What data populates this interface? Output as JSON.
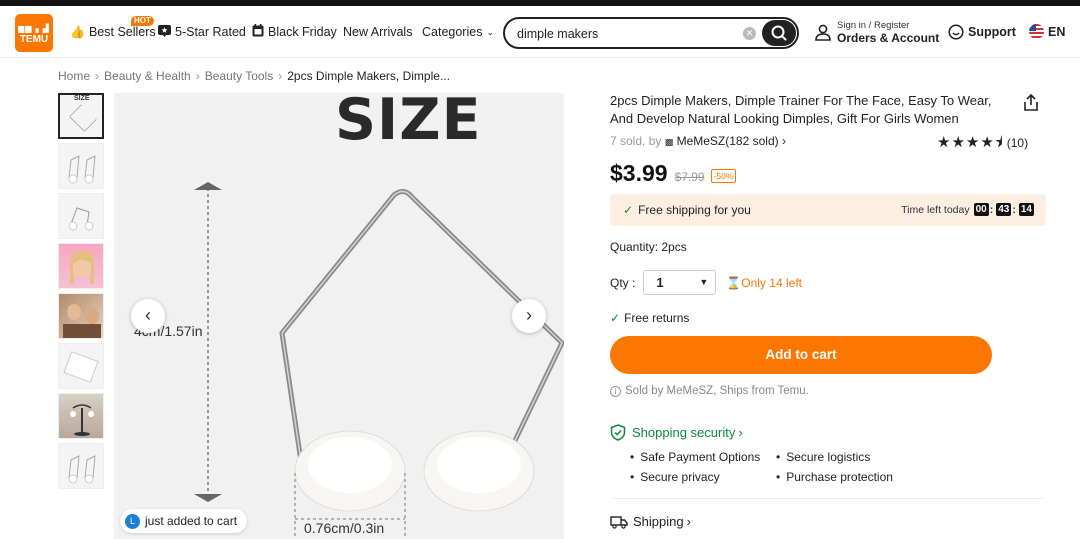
{
  "header": {
    "logo_top": "▆▆ ▖▟",
    "logo_text": "TEMU",
    "nav": [
      {
        "label": "Best Sellers",
        "icon": "thumbs-up-icon",
        "badge": "HOT"
      },
      {
        "label": "5-Star Rated",
        "icon": "star-badge-icon"
      },
      {
        "label": "Black Friday",
        "icon": "calendar-icon"
      },
      {
        "label": "New Arrivals"
      },
      {
        "label": "Categories",
        "icon": "chevron-down-icon"
      }
    ],
    "search_value": "dimple makers",
    "account_small": "Sign in / Register",
    "account_big": "Orders & Account",
    "support": "Support",
    "lang": "EN"
  },
  "breadcrumb": [
    "Home",
    "Beauty & Health",
    "Beauty Tools",
    "2pcs Dimple Makers, Dimple..."
  ],
  "gallery": {
    "size_label": "SIZE",
    "dim_height": "4cm/1.57in",
    "dim_width": "0.76cm/0.3in",
    "toast_avatar": "L",
    "toast_text": "just added to cart"
  },
  "product": {
    "title": "2pcs Dimple Makers, Dimple Trainer For The Face, Easy To Wear, And Develop Natural Looking Dimples, Gift For Girls Women",
    "sold_prefix": "7 sold, by",
    "store": "MeMeSZ(182 sold)",
    "rating": 4.5,
    "rating_count": "(10)",
    "price": "$3.99",
    "old_price": "$7.99",
    "discount": "-50%",
    "free_shipping": "Free shipping for you",
    "time_left_label": "Time left today",
    "timer": [
      "00",
      "43",
      "14"
    ],
    "quantity_text": "Quantity: 2pcs",
    "qty_label": "Qty :",
    "qty_value": "1",
    "stock": "Only 14 left",
    "returns": "Free returns",
    "add_to_cart": "Add to cart",
    "sold_by": "Sold by MeMeSZ, Ships from Temu.",
    "security_title": "Shopping security",
    "security_items": [
      "Safe Payment Options",
      "Secure logistics",
      "Secure privacy",
      "Purchase protection"
    ],
    "shipping_title": "Shipping"
  },
  "colors": {
    "brand": "#fb7701",
    "success": "#0a8a3a"
  }
}
